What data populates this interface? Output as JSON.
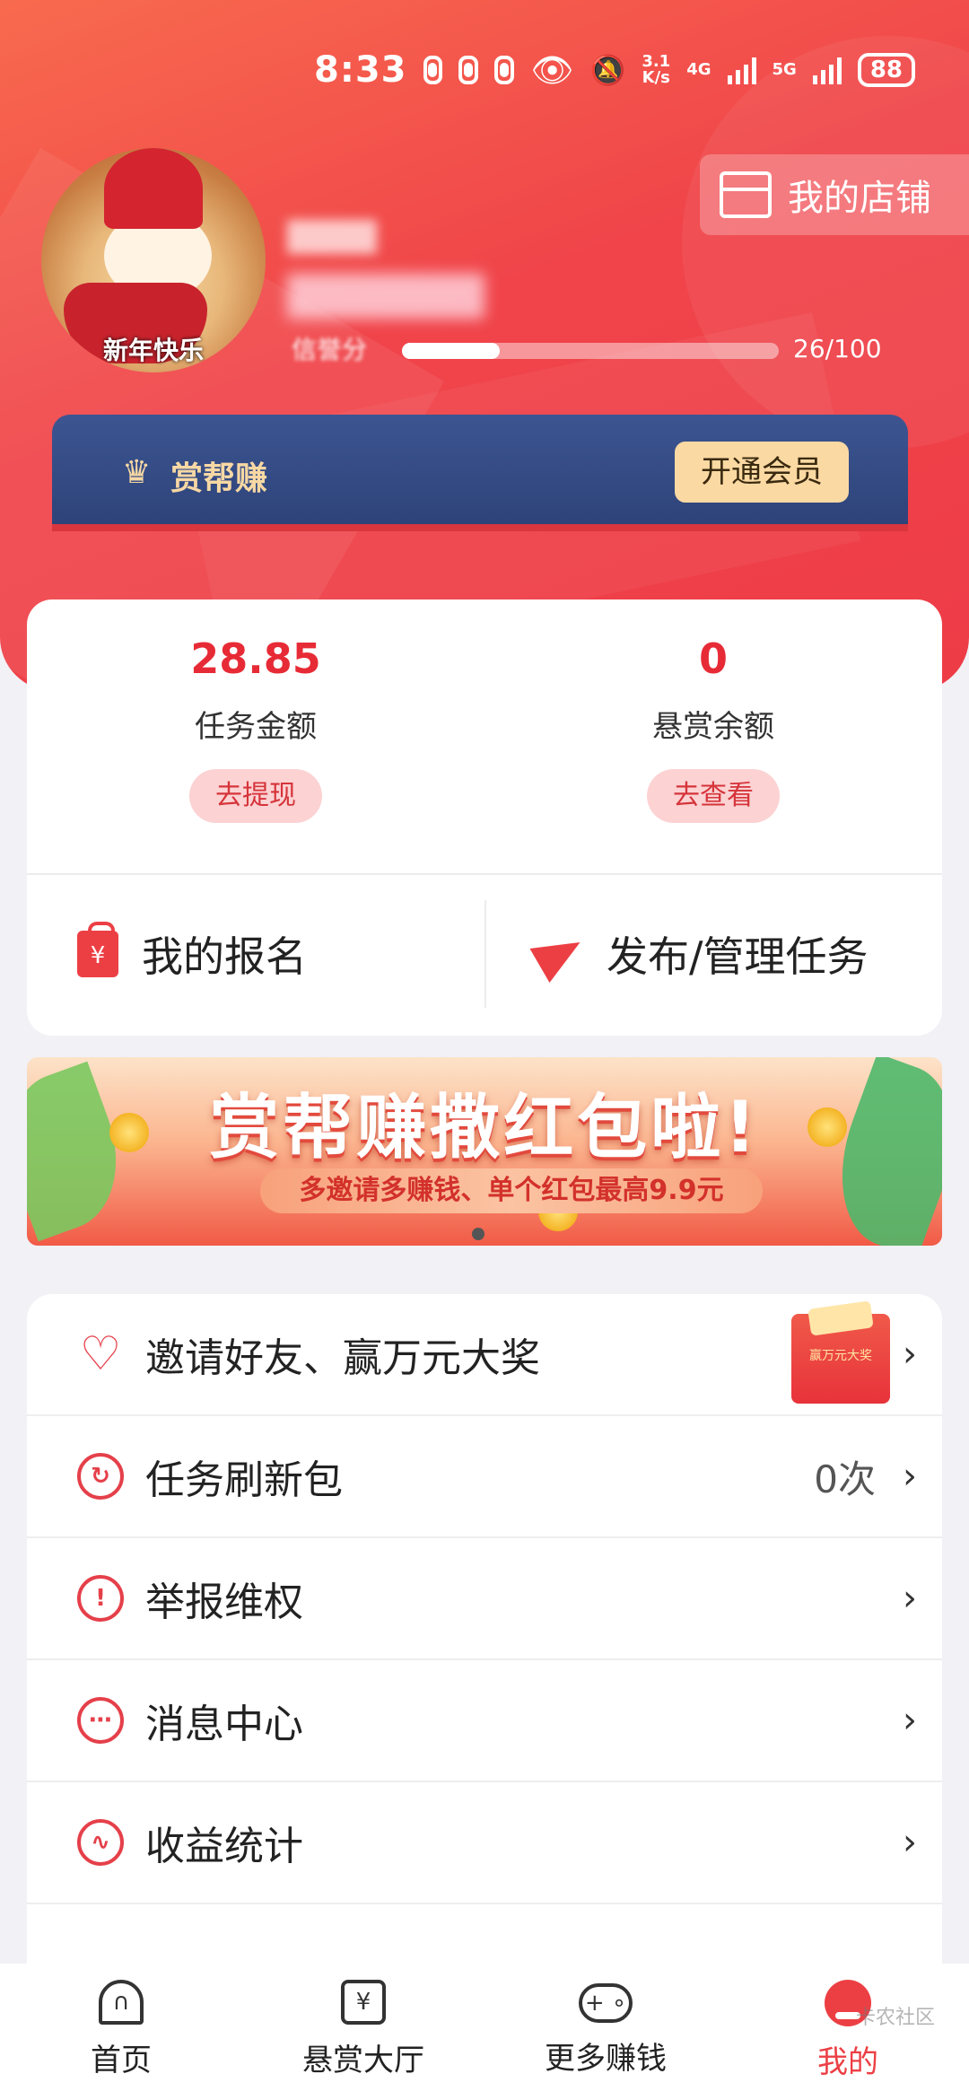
{
  "status_bar": {
    "time": "8:33",
    "net_speed_value": "3.1",
    "net_speed_unit": "K/s",
    "network_a": "4G",
    "network_b": "5G",
    "battery": "88"
  },
  "profile": {
    "avatar_caption": "新年快乐",
    "credit_label": "信誉分",
    "credit_value": "26/100",
    "credit_progress": 0.26
  },
  "shop": {
    "label": "我的店铺"
  },
  "vip": {
    "title": "赏帮赚",
    "button": "开通会员"
  },
  "balances": [
    {
      "value": "28.85",
      "label": "任务金额",
      "button": "去提现"
    },
    {
      "value": "0",
      "label": "悬赏余额",
      "button": "去查看"
    }
  ],
  "actions": [
    {
      "label": "我的报名",
      "icon": "bag-yen-icon"
    },
    {
      "label": "发布/管理任务",
      "icon": "paper-plane-icon"
    }
  ],
  "banner": {
    "title": "赏帮赚撒红包啦!",
    "subtitle": "多邀请多赚钱、单个红包最高9.9元"
  },
  "menu": [
    {
      "label": "邀请好友、赢万元大奖",
      "icon": "heart-icon",
      "value": "",
      "promo": "赢万元大奖"
    },
    {
      "label": "任务刷新包",
      "icon": "refresh-icon",
      "value": "0次"
    },
    {
      "label": "举报维权",
      "icon": "warning-icon",
      "value": ""
    },
    {
      "label": "消息中心",
      "icon": "chat-icon",
      "value": ""
    },
    {
      "label": "收益统计",
      "icon": "chart-icon",
      "value": ""
    }
  ],
  "nav": [
    {
      "label": "首页",
      "icon": "home-icon",
      "active": false
    },
    {
      "label": "悬赏大厅",
      "icon": "yen-doc-icon",
      "active": false
    },
    {
      "label": "更多赚钱",
      "icon": "gamepad-icon",
      "active": false
    },
    {
      "label": "我的",
      "icon": "profile-icon",
      "active": true
    }
  ],
  "watermark": "卡农社区",
  "colors": {
    "brand_red": "#ec3f44",
    "vip_navy": "#33487f",
    "vip_gold": "#fbd9a2"
  }
}
